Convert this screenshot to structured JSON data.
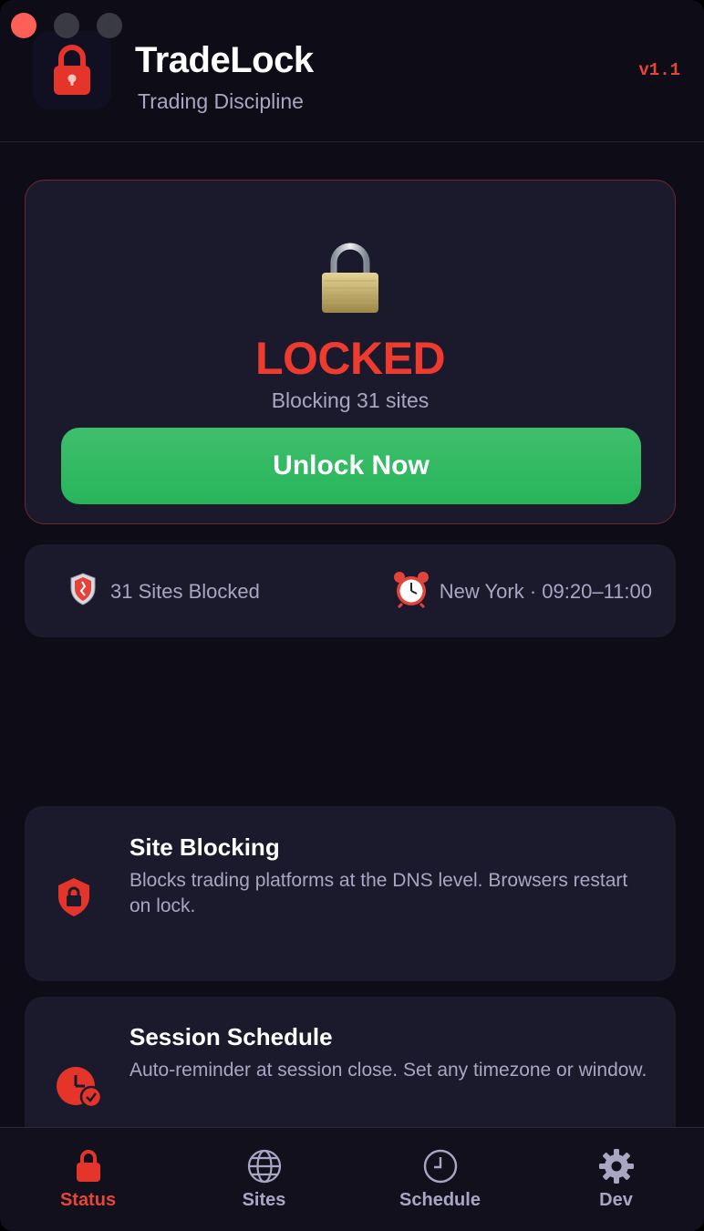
{
  "window": {
    "controls": [
      "close",
      "minimize",
      "maximize"
    ]
  },
  "header": {
    "title": "TradeLock",
    "subtitle": "Trading Discipline",
    "version": "v1.1",
    "app_icon": "lock-icon"
  },
  "status": {
    "icon": "padlock-icon",
    "state_label": "LOCKED",
    "blocking_text": "Blocking 31 sites",
    "unlock_button": "Unlock Now"
  },
  "info": {
    "sites_blocked": "31 Sites Blocked",
    "sites_icon": "shield-icon",
    "schedule": "New York · 09:20–11:00",
    "schedule_icon": "alarm-clock-icon"
  },
  "features": [
    {
      "title": "Site Blocking",
      "description": "Blocks trading platforms at the DNS level. Browsers restart on lock.",
      "icon": "shield-lock-icon"
    },
    {
      "title": "Session Schedule",
      "description": "Auto-reminder at session close. Set any timezone or window.",
      "icon": "clock-check-icon"
    }
  ],
  "tabs": [
    {
      "label": "Status",
      "icon": "lock-icon",
      "active": true
    },
    {
      "label": "Sites",
      "icon": "globe-icon",
      "active": false
    },
    {
      "label": "Schedule",
      "icon": "clock-icon",
      "active": false
    },
    {
      "label": "Dev",
      "icon": "gear-icon",
      "active": false
    }
  ],
  "colors": {
    "accent_red": "#e8453a",
    "accent_green": "#27b55a",
    "background": "#0d0c17",
    "card": "#1b1a2c",
    "muted_text": "#a9a6c4"
  }
}
